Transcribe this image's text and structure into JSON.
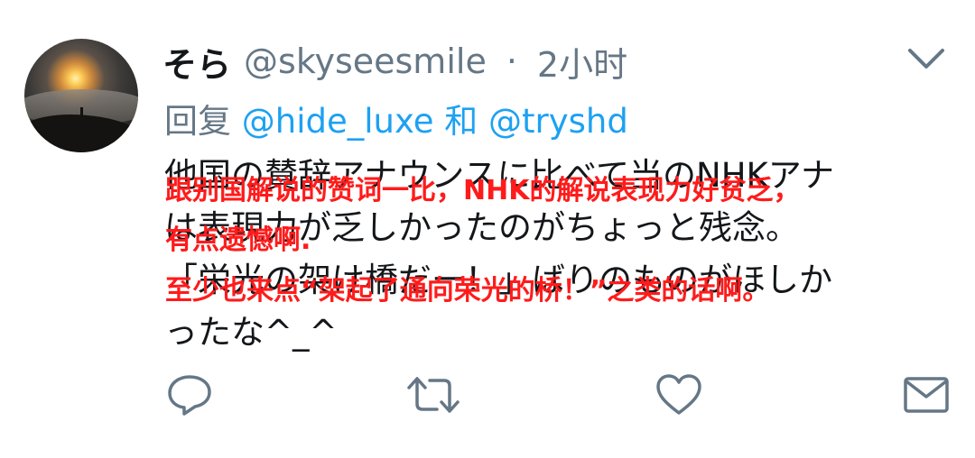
{
  "tweet": {
    "display_name": "そら",
    "handle": "@skyseesmile",
    "separator": "·",
    "time": "2小时",
    "reply_prefix": "回复",
    "reply_to_1": "@hide_luxe",
    "reply_and": "和",
    "reply_to_2": "@tryshd",
    "body_lines": [
      "他国の賛辞アナウンスに比べて当のNHKアナ",
      "は表現力が乏しかったのがちょっと残念。",
      "「栄光の架け橋だー！」ばりのものがほしか",
      "ったな^_^"
    ]
  },
  "overlay_translation": {
    "line1": "跟别国解说的赞词一比，NHK的解说表现力好贫乏，",
    "line2": "有点遗憾啊.",
    "line3": "至少也来点“架起了通向荣光的桥！”之类的话啊。",
    "color": "#ff1b1b"
  },
  "actions": {
    "reply_icon": "reply-icon",
    "retweet_icon": "retweet-icon",
    "like_icon": "heart-icon",
    "dm_icon": "envelope-icon"
  },
  "colors": {
    "secondary_text": "#657786",
    "link": "#1da1f2",
    "primary_text": "#14171a"
  }
}
